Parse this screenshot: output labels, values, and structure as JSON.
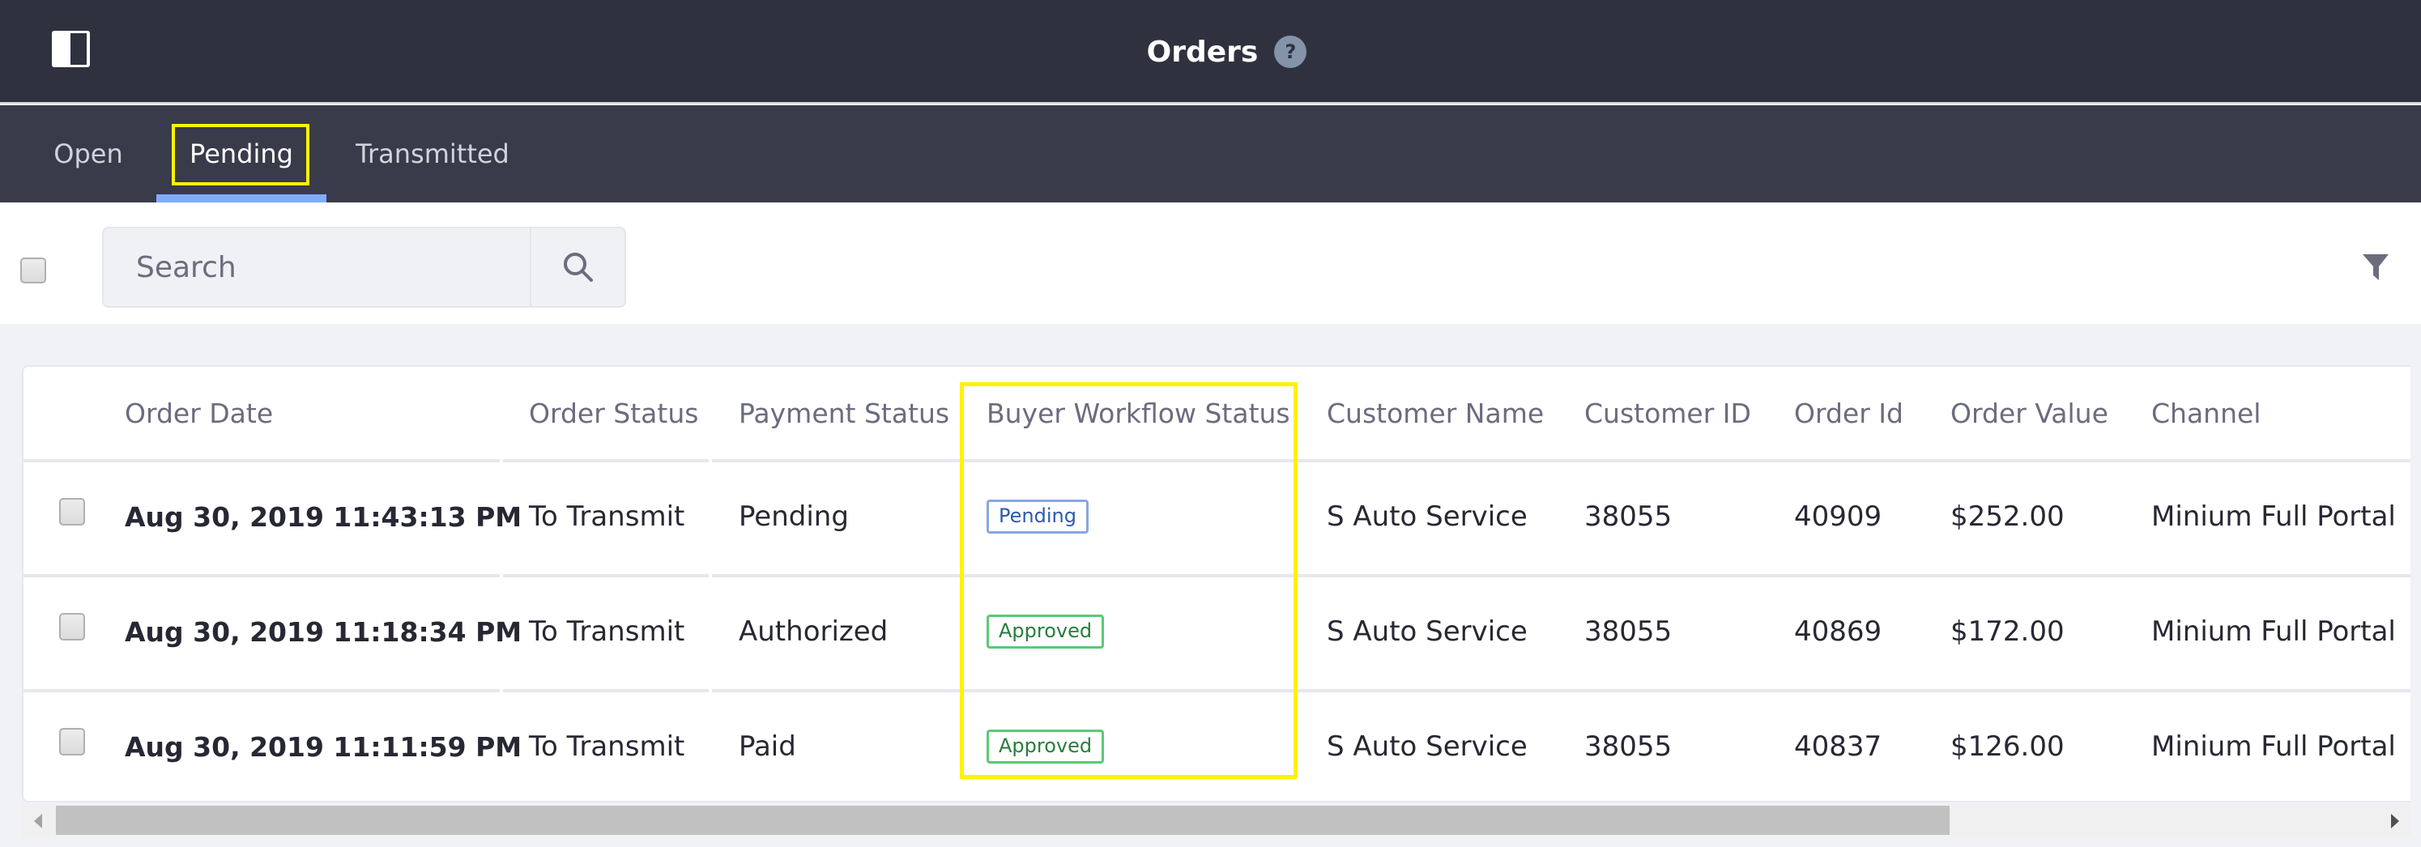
{
  "header": {
    "title": "Orders",
    "help_icon": "?",
    "sidebar_toggle_icon": "sidebar-toggle-icon"
  },
  "tabs": [
    {
      "label": "Open",
      "active": false
    },
    {
      "label": "Pending",
      "active": true
    },
    {
      "label": "Transmitted",
      "active": false
    }
  ],
  "toolbar": {
    "search_placeholder": "Search",
    "search_value": "",
    "search_icon": "search-icon",
    "filter_icon": "filter-icon"
  },
  "table": {
    "columns": [
      "Order Date",
      "Order Status",
      "Payment Status",
      "Buyer Workflow Status",
      "Customer Name",
      "Customer ID",
      "Order Id",
      "Order Value",
      "Channel"
    ],
    "rows": [
      {
        "order_date": "Aug 30, 2019 11:43:13 PM",
        "order_status": "To Transmit",
        "payment_status": "Pending",
        "buyer_workflow_status": "Pending",
        "buyer_workflow_status_type": "info",
        "customer_name": "S Auto Service",
        "customer_id": "38055",
        "order_id": "40909",
        "order_value": "$252.00",
        "channel": "Minium Full Portal"
      },
      {
        "order_date": "Aug 30, 2019 11:18:34 PM",
        "order_status": "To Transmit",
        "payment_status": "Authorized",
        "buyer_workflow_status": "Approved",
        "buyer_workflow_status_type": "success",
        "customer_name": "S Auto Service",
        "customer_id": "38055",
        "order_id": "40869",
        "order_value": "$172.00",
        "channel": "Minium Full Portal"
      },
      {
        "order_date": "Aug 30, 2019 11:11:59 PM",
        "order_status": "To Transmit",
        "payment_status": "Paid",
        "buyer_workflow_status": "Approved",
        "buyer_workflow_status_type": "success",
        "customer_name": "S Auto Service",
        "customer_id": "38055",
        "order_id": "40837",
        "order_value": "$126.00",
        "channel": "Minium Full Portal"
      }
    ]
  },
  "colors": {
    "header_bg": "#30313f",
    "tabs_bg": "#393a4a",
    "active_tab_underline": "#80acff",
    "highlight": "#fff200",
    "badge_info": "#2e5aac",
    "badge_success": "#287d3c"
  }
}
